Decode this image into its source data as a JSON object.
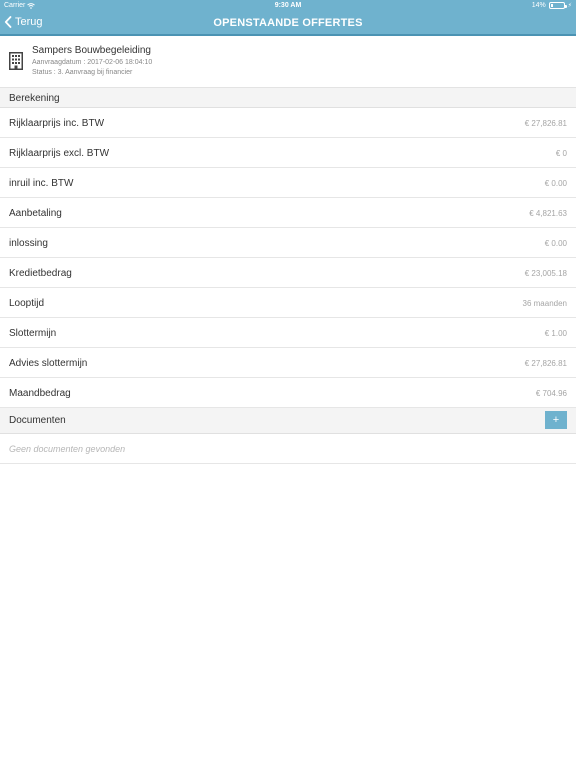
{
  "statusbar": {
    "carrier": "Carrier",
    "time": "9:30 AM",
    "battery": "14%"
  },
  "navbar": {
    "back_label": "Terug",
    "title": "OPENSTAANDE OFFERTES"
  },
  "company": {
    "name": "Sampers Bouwbegeleiding",
    "date": "Aanvraagdatum : 2017-02-06 18:04:10",
    "status": "Status : 3. Aanvraag bij financier",
    "icon": "building-icon"
  },
  "calculation": {
    "header": "Berekening",
    "rows": [
      {
        "label": "Rijklaarprijs inc. BTW",
        "value": "€ 27,826.81"
      },
      {
        "label": "Rijklaarprijs excl. BTW",
        "value": "€ 0"
      },
      {
        "label": "inruil inc. BTW",
        "value": "€ 0.00"
      },
      {
        "label": "Aanbetaling",
        "value": "€ 4,821.63"
      },
      {
        "label": "inlossing",
        "value": "€ 0.00"
      },
      {
        "label": "Kredietbedrag",
        "value": "€ 23,005.18"
      },
      {
        "label": "Looptijd",
        "value": "36 maanden"
      },
      {
        "label": "Slottermijn",
        "value": "€ 1.00"
      },
      {
        "label": "Advies slottermijn",
        "value": "€ 27,826.81"
      },
      {
        "label": "Maandbedrag",
        "value": "€ 704.96"
      }
    ]
  },
  "documents": {
    "header": "Documenten",
    "add_label": "+",
    "empty_text": "Geen documenten gevonden"
  },
  "colors": {
    "accent": "#6fb2ce",
    "accent_dark": "#4b93b3",
    "section_bg": "#f4f4f4"
  }
}
